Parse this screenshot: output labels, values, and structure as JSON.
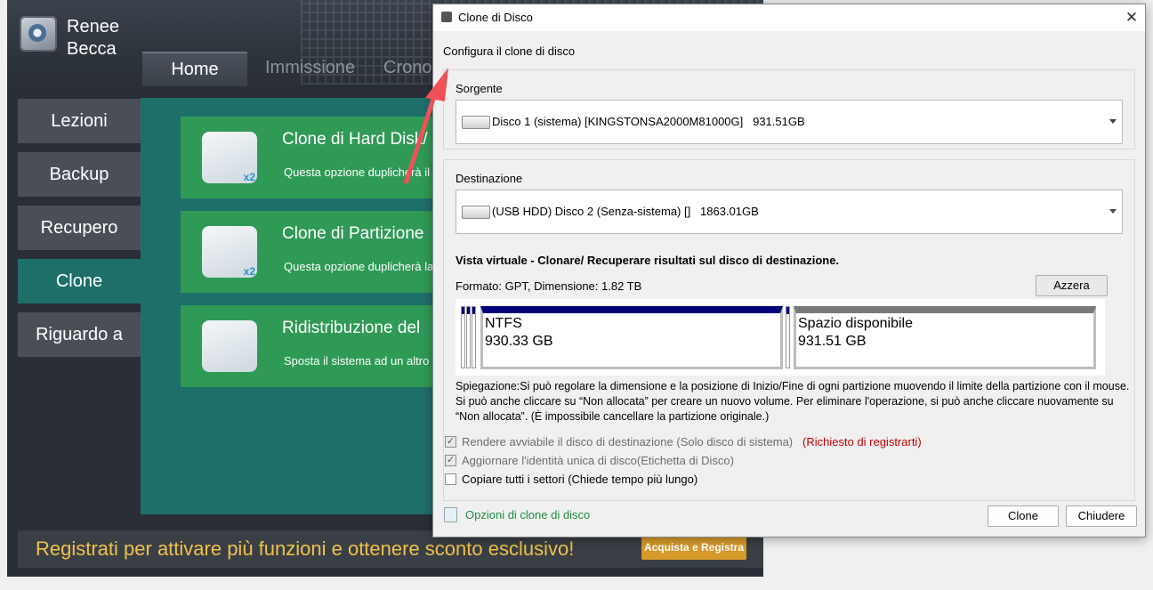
{
  "app": {
    "brand_line1": "Renee",
    "brand_line2": "Becca",
    "tabs": [
      "Home",
      "Immissione",
      "Crono"
    ],
    "sidebar": [
      "Lezioni",
      "Backup",
      "Recupero",
      "Clone",
      "Riguardo a"
    ],
    "cards": [
      {
        "title": "Clone di Hard Disk/",
        "desc": "Questa opzione duplicherà il",
        "badge": "x2"
      },
      {
        "title": "Clone di Partizione",
        "desc": "Questa opzione duplicherà la",
        "badge": "x2"
      },
      {
        "title": "Ridistribuzione del",
        "desc": "Sposta il sistema ad un altro"
      }
    ],
    "banner_text": "Registrati per attivare più funzioni e ottenere sconto esclusivo!",
    "buy_label": "Acquista e Registra"
  },
  "dialog": {
    "title": "Clone di Disco",
    "close": "✕",
    "config_label": "Configura il clone di disco",
    "source_label": "Sorgente",
    "source_value": "Disco 1 (sistema) [KINGSTONSA2000M81000G]   931.51GB",
    "dest_label": "Destinazione",
    "dest_value": "(USB HDD) Disco 2 (Senza-sistema) []   1863.01GB",
    "vista_title": "Vista virtuale - Clonare/ Recuperare risultati sul disco di destinazione.",
    "formato": "Formato: GPT,  Dimensione: 1.82 TB",
    "azzera": "Azzera",
    "partitions": [
      {
        "name": "NTFS",
        "size": "930.33 GB"
      },
      {
        "name": "Spazio disponibile",
        "size": "931.51 GB"
      }
    ],
    "spiegazione": "Spiegazione:Si può regolare la dimensione e la posizione di Inizio/Fine di ogni partizione muovendo il limite della partizione con il mouse. Si può anche cliccare su “Non allocata” per creare un nuovo volume. Per eliminare l'operazione, si può anche cliccare nuovamente su “Non allocata”. (È impossibile cancellare la partizione originale.)",
    "checks": [
      {
        "label": "Rendere avviabile il disco di destinazione (Solo disco di sistema)",
        "checked": true,
        "disabled": true
      },
      {
        "label": "Aggiornare l'identità unica di disco(Etichetta di Disco)",
        "checked": true,
        "disabled": true
      },
      {
        "label": "Copiare tutti i settori (Chiede tempo più lungo)",
        "checked": false,
        "disabled": false
      }
    ],
    "required_note": "(Richiesto di registrarti)",
    "options_link": "Opzioni di clone di disco",
    "clone_btn": "Clone",
    "close_btn": "Chiudere"
  },
  "colors": {
    "accent_green": "#2f9a56",
    "teal": "#1e6f6a",
    "arrow": "#f0505a",
    "partition_blue": "#00007a"
  }
}
